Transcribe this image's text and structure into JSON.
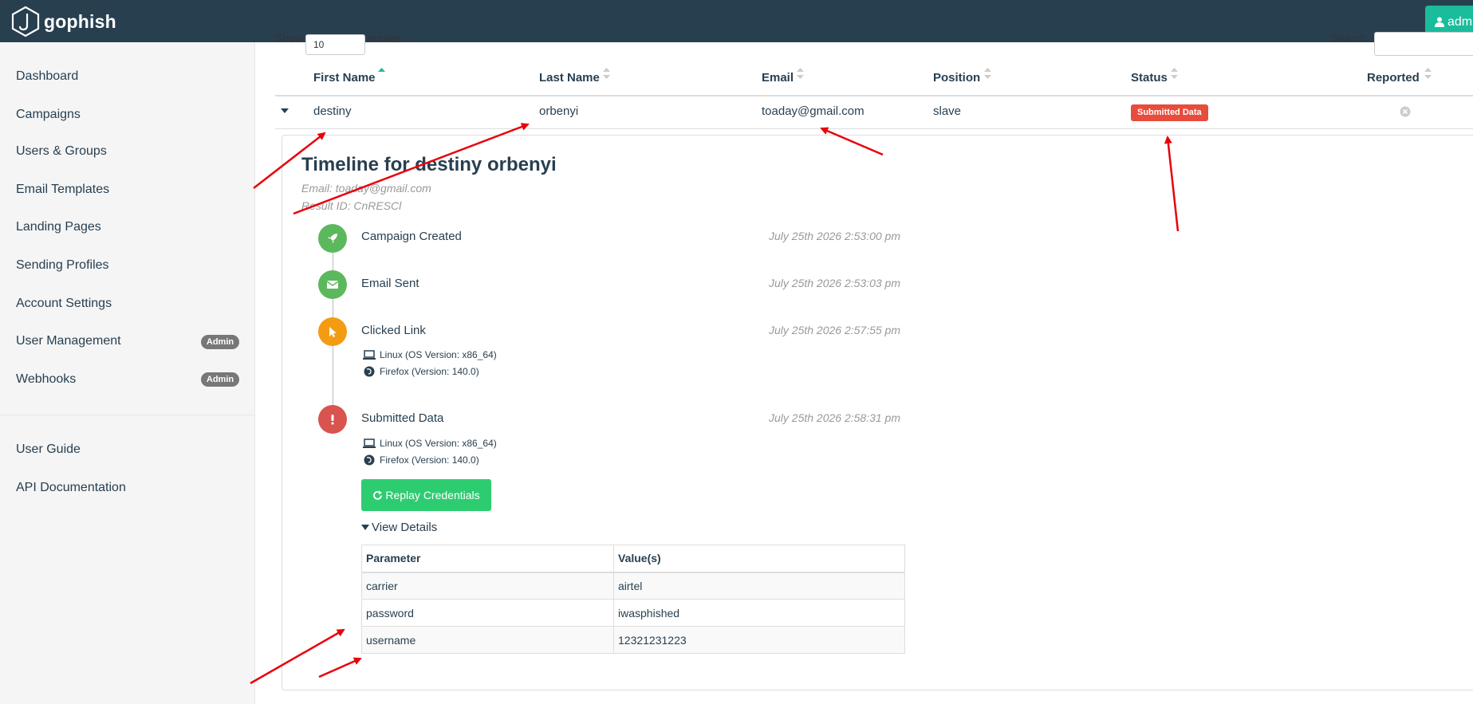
{
  "navbar": {
    "brand": "gophish",
    "user_button": "admi"
  },
  "sidebar": {
    "items": [
      {
        "label": "Dashboard"
      },
      {
        "label": "Campaigns"
      },
      {
        "label": "Users & Groups"
      },
      {
        "label": "Email Templates"
      },
      {
        "label": "Landing Pages"
      },
      {
        "label": "Sending Profiles"
      },
      {
        "label": "Account Settings"
      },
      {
        "label": "User Management",
        "badge": "Admin"
      },
      {
        "label": "Webhooks",
        "badge": "Admin"
      }
    ],
    "footer_items": [
      {
        "label": "User Guide"
      },
      {
        "label": "API Documentation"
      }
    ]
  },
  "table_controls": {
    "show_label": "Show",
    "show_value": "10",
    "entries_label": "entries",
    "search_label": "Search:"
  },
  "results_table": {
    "columns": [
      "First Name",
      "Last Name",
      "Email",
      "Position",
      "Status",
      "Reported"
    ],
    "row": {
      "first_name": "destiny",
      "last_name": "orbenyi",
      "email": "toaday@gmail.com",
      "position": "slave",
      "status": "Submitted Data"
    }
  },
  "timeline": {
    "title": "Timeline for destiny orbenyi",
    "email": "Email: toaday@gmail.com",
    "result_id": "Result ID: CnRESCl",
    "events": [
      {
        "label": "Campaign Created",
        "time": "July 25th 2026 2:53:00 pm",
        "icon": "rocket-icon",
        "color": "#5cb85c"
      },
      {
        "label": "Email Sent",
        "time": "July 25th 2026 2:53:03 pm",
        "icon": "envelope-icon",
        "color": "#5cb85c"
      },
      {
        "label": "Clicked Link",
        "time": "July 25th 2026 2:57:55 pm",
        "icon": "mouse-pointer-icon",
        "color": "#f39c12",
        "os": "Linux (OS Version: x86_64)",
        "browser": "Firefox (Version: 140.0)"
      },
      {
        "label": "Submitted Data",
        "time": "July 25th 2026 2:58:31 pm",
        "icon": "exclamation-icon",
        "color": "#d9534f",
        "os": "Linux (OS Version: x86_64)",
        "browser": "Firefox (Version: 140.0)"
      }
    ],
    "replay_button": "Replay Credentials",
    "view_details": "View Details",
    "params_table": {
      "headers": [
        "Parameter",
        "Value(s)"
      ],
      "rows": [
        {
          "param": "carrier",
          "value": "airtel"
        },
        {
          "param": "password",
          "value": "iwasphished"
        },
        {
          "param": "username",
          "value": "12321231223"
        }
      ]
    }
  },
  "colors": {
    "navbar": "#283f50",
    "accent": "#1abc9c",
    "success": "#2ecc71",
    "danger": "#e74c3c",
    "annotation": "#e8000b"
  }
}
